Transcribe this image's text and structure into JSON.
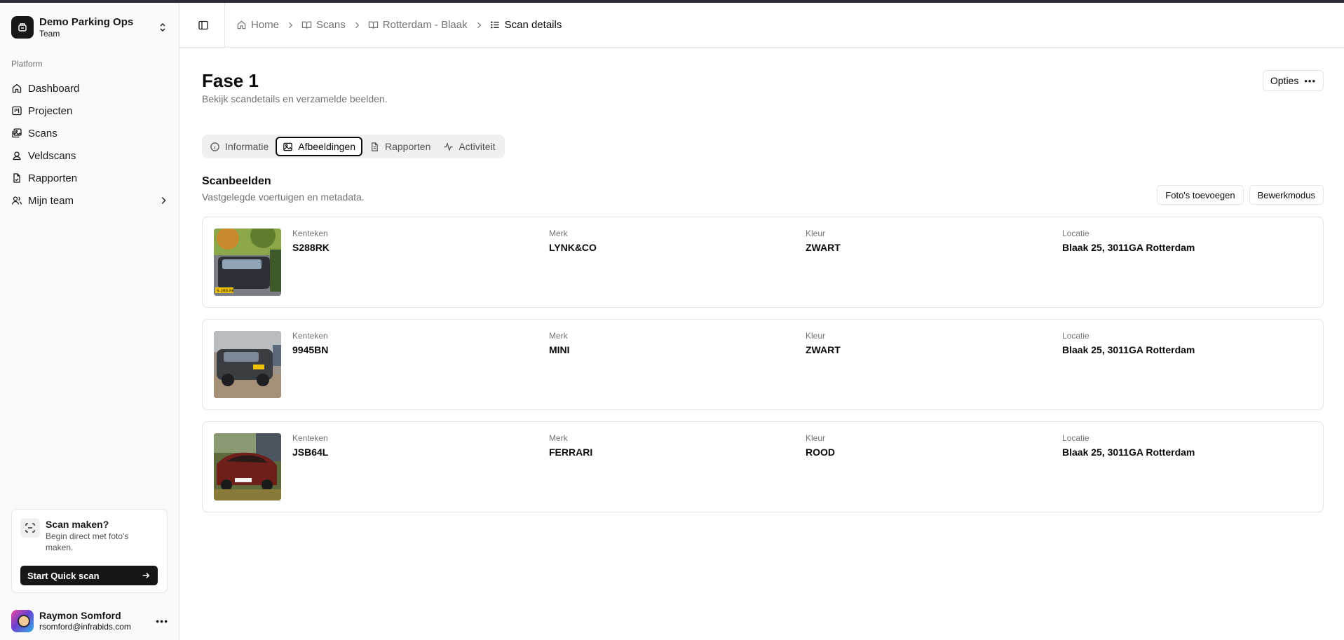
{
  "team": {
    "name": "Demo Parking Ops",
    "plan": "Team"
  },
  "sidebar": {
    "group_label": "Platform",
    "items": [
      {
        "label": "Dashboard",
        "icon": "home-icon"
      },
      {
        "label": "Projecten",
        "icon": "kanban-icon"
      },
      {
        "label": "Scans",
        "icon": "images-icon"
      },
      {
        "label": "Veldscans",
        "icon": "map-pin-user-icon"
      },
      {
        "label": "Rapporten",
        "icon": "file-check-icon"
      },
      {
        "label": "Mijn team",
        "icon": "users-icon"
      }
    ]
  },
  "promo": {
    "title": "Scan maken?",
    "description": "Begin direct met foto's maken.",
    "button_label": "Start Quick scan"
  },
  "user": {
    "name": "Raymon Somford",
    "email": "rsomford@infrabids.com"
  },
  "breadcrumb": [
    {
      "label": "Home",
      "icon": "home-icon"
    },
    {
      "label": "Scans",
      "icon": "book-open-icon"
    },
    {
      "label": "Rotterdam - Blaak",
      "icon": "book-open-icon"
    },
    {
      "label": "Scan details",
      "icon": "list-icon"
    }
  ],
  "page": {
    "title": "Fase 1",
    "subtitle": "Bekijk scandetails en verzamelde beelden.",
    "options_label": "Opties"
  },
  "tabs": [
    {
      "label": "Informatie",
      "icon": "info-icon",
      "active": false
    },
    {
      "label": "Afbeeldingen",
      "icon": "image-icon",
      "active": true
    },
    {
      "label": "Rapporten",
      "icon": "file-text-icon",
      "active": false
    },
    {
      "label": "Activiteit",
      "icon": "activity-icon",
      "active": false
    }
  ],
  "section": {
    "title": "Scanbeelden",
    "subtitle": "Vastgelegde voertuigen en metadata.",
    "add_photos_label": "Foto's toevoegen",
    "edit_mode_label": "Bewerkmodus"
  },
  "field_labels": {
    "plate": "Kenteken",
    "brand": "Merk",
    "color": "Kleur",
    "location": "Locatie"
  },
  "scans": [
    {
      "plate": "S288RK",
      "brand": "LYNK&CO",
      "color": "ZWART",
      "location": "Blaak 25, 3011GA Rotterdam",
      "photo_plate_text": "S-288-RK"
    },
    {
      "plate": "9945BN",
      "brand": "MINI",
      "color": "ZWART",
      "location": "Blaak 25, 3011GA Rotterdam",
      "photo_plate_text": ""
    },
    {
      "plate": "JSB64L",
      "brand": "FERRARI",
      "color": "ROOD",
      "location": "Blaak 25, 3011GA Rotterdam",
      "photo_plate_text": ""
    }
  ],
  "colors": {
    "primary": "#171717",
    "muted_text": "#737373",
    "border": "#e5e5e5",
    "sidebar_bg": "#fafafa"
  }
}
